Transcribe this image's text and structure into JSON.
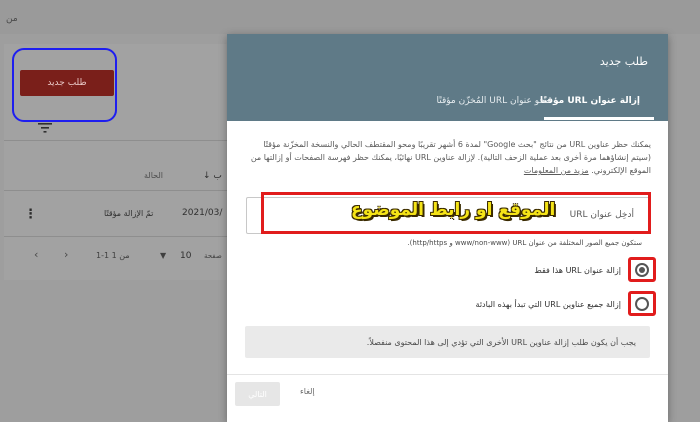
{
  "background": {
    "top_text": "من",
    "new_request_button": "طلب جديد",
    "table": {
      "col_status": "الحالة",
      "col_sort": "↓ ب",
      "row": {
        "menu": "⋮",
        "status": "تمّ الإزالة مؤقتًا",
        "date": "2021/03/"
      },
      "pagination": {
        "range": "1-1 من 1",
        "page_size": "10",
        "page_size_label": "صفحة",
        "prev": "‹",
        "next": "›",
        "caret": "▼"
      }
    }
  },
  "dialog": {
    "title": "طلب جديد",
    "tabs": [
      {
        "label": "إزالة عنوان URL مؤقتًا",
        "active": true
      },
      {
        "label": "محو عنوان URL المُخزّن مؤقتًا",
        "active": false
      }
    ],
    "description": "يمكنك حظر عناوين URL من نتائج \"بحث Google\" لمدة 6 أشهر تقريبًا ومحو المقتطف الحالي والنسخة المخزّنة مؤقتًا (سيتم إنشاؤهما مرة أخرى بعد عملية الزحف التالية). لإزالة عناوين URL نهائيًا، يمكنك حظر فهرسة الصفحات أو إزالتها من الموقع الإلكتروني.",
    "learn_more": "مزيد من المعلومات",
    "url_placeholder": "أدخِل عنوان URL",
    "overlay_text": "الموقع او رابط الموضوع",
    "url_hint": "ستكون جميع الصور المختلفة من عنوان URL (www/non-www و http/https).",
    "options": [
      {
        "label": "إزالة عنوان URL هذا فقط",
        "checked": true
      },
      {
        "label": "إزالة جميع عناوين URL التي تبدأ بهذه البادئة",
        "checked": false
      }
    ],
    "info": "يجب أن يكون طلب إزالة عناوين URL الأخرى التي تؤدي إلى هذا المحتوى منفصلاً.",
    "next_button": "التالي",
    "cancel_button": "إلغاء"
  },
  "colors": {
    "header": "#5f7a87",
    "annotation_red": "#e11c1c",
    "annotation_blue": "#1e1ef0",
    "overlay_yellow": "#f5e417",
    "bg_button": "#7a1f1a"
  },
  "icons": {
    "filter": "filter-icon",
    "menu": "more-vert-icon",
    "sort": "arrow-down-icon"
  }
}
